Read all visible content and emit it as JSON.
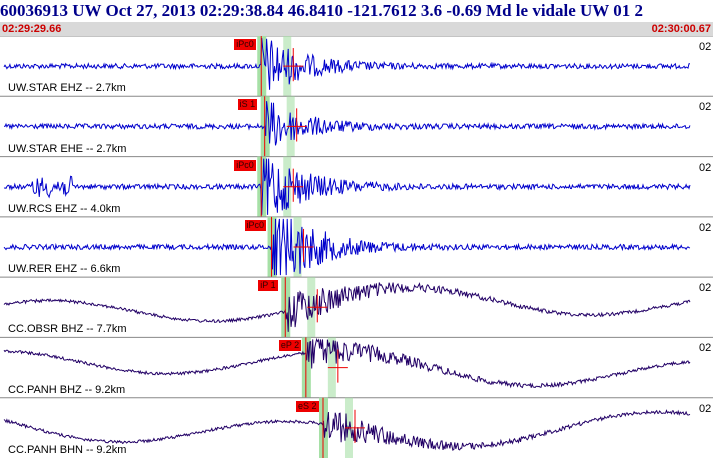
{
  "header": {
    "title": "60036913 UW Oct 27, 2013 02:29:38.84   46.8410 -121.7612  3.6 -0.69 Md le vidale UW 01   2",
    "start_time": "02:29:29.66",
    "end_time": "02:30:00.67"
  },
  "colors": {
    "highfreq_trace": "#0000cc",
    "lowfreq_trace": "#220066",
    "pick": "#ee0000",
    "window": "#a6e0a6",
    "timebar": "#d9d9d9"
  },
  "traces": [
    {
      "label": "UW.STAR EHZ -- 2.7km",
      "edge": "02",
      "pick": "iPc0",
      "kind": "hf",
      "onset": 0.375,
      "amp": 0.55
    },
    {
      "label": "UW.STAR EHE -- 2.7km",
      "edge": "02",
      "pick": "iS 1",
      "kind": "hf",
      "onset": 0.38,
      "amp": 0.45
    },
    {
      "label": "UW.RCS EHZ -- 4.0km",
      "edge": "02",
      "pick": "iPc0",
      "kind": "hf",
      "onset": 0.375,
      "amp": 0.7
    },
    {
      "label": "UW.RER EHZ -- 6.6km",
      "edge": "02",
      "pick": "iPc0",
      "kind": "hf",
      "onset": 0.39,
      "amp": 0.9
    },
    {
      "label": "CC.OBSR BHZ -- 7.7km",
      "edge": "02",
      "pick": "iP 1",
      "kind": "lf",
      "onset": 0.41,
      "amp": 0.6
    },
    {
      "label": "CC.PANH BHZ -- 9.2km",
      "edge": "02",
      "pick": "eP 2",
      "kind": "lf",
      "onset": 0.44,
      "amp": 0.5
    },
    {
      "label": "CC.PANH BHN -- 9.2km",
      "edge": "02",
      "pick": "eS 2",
      "kind": "lf",
      "onset": 0.465,
      "amp": 0.5
    }
  ]
}
